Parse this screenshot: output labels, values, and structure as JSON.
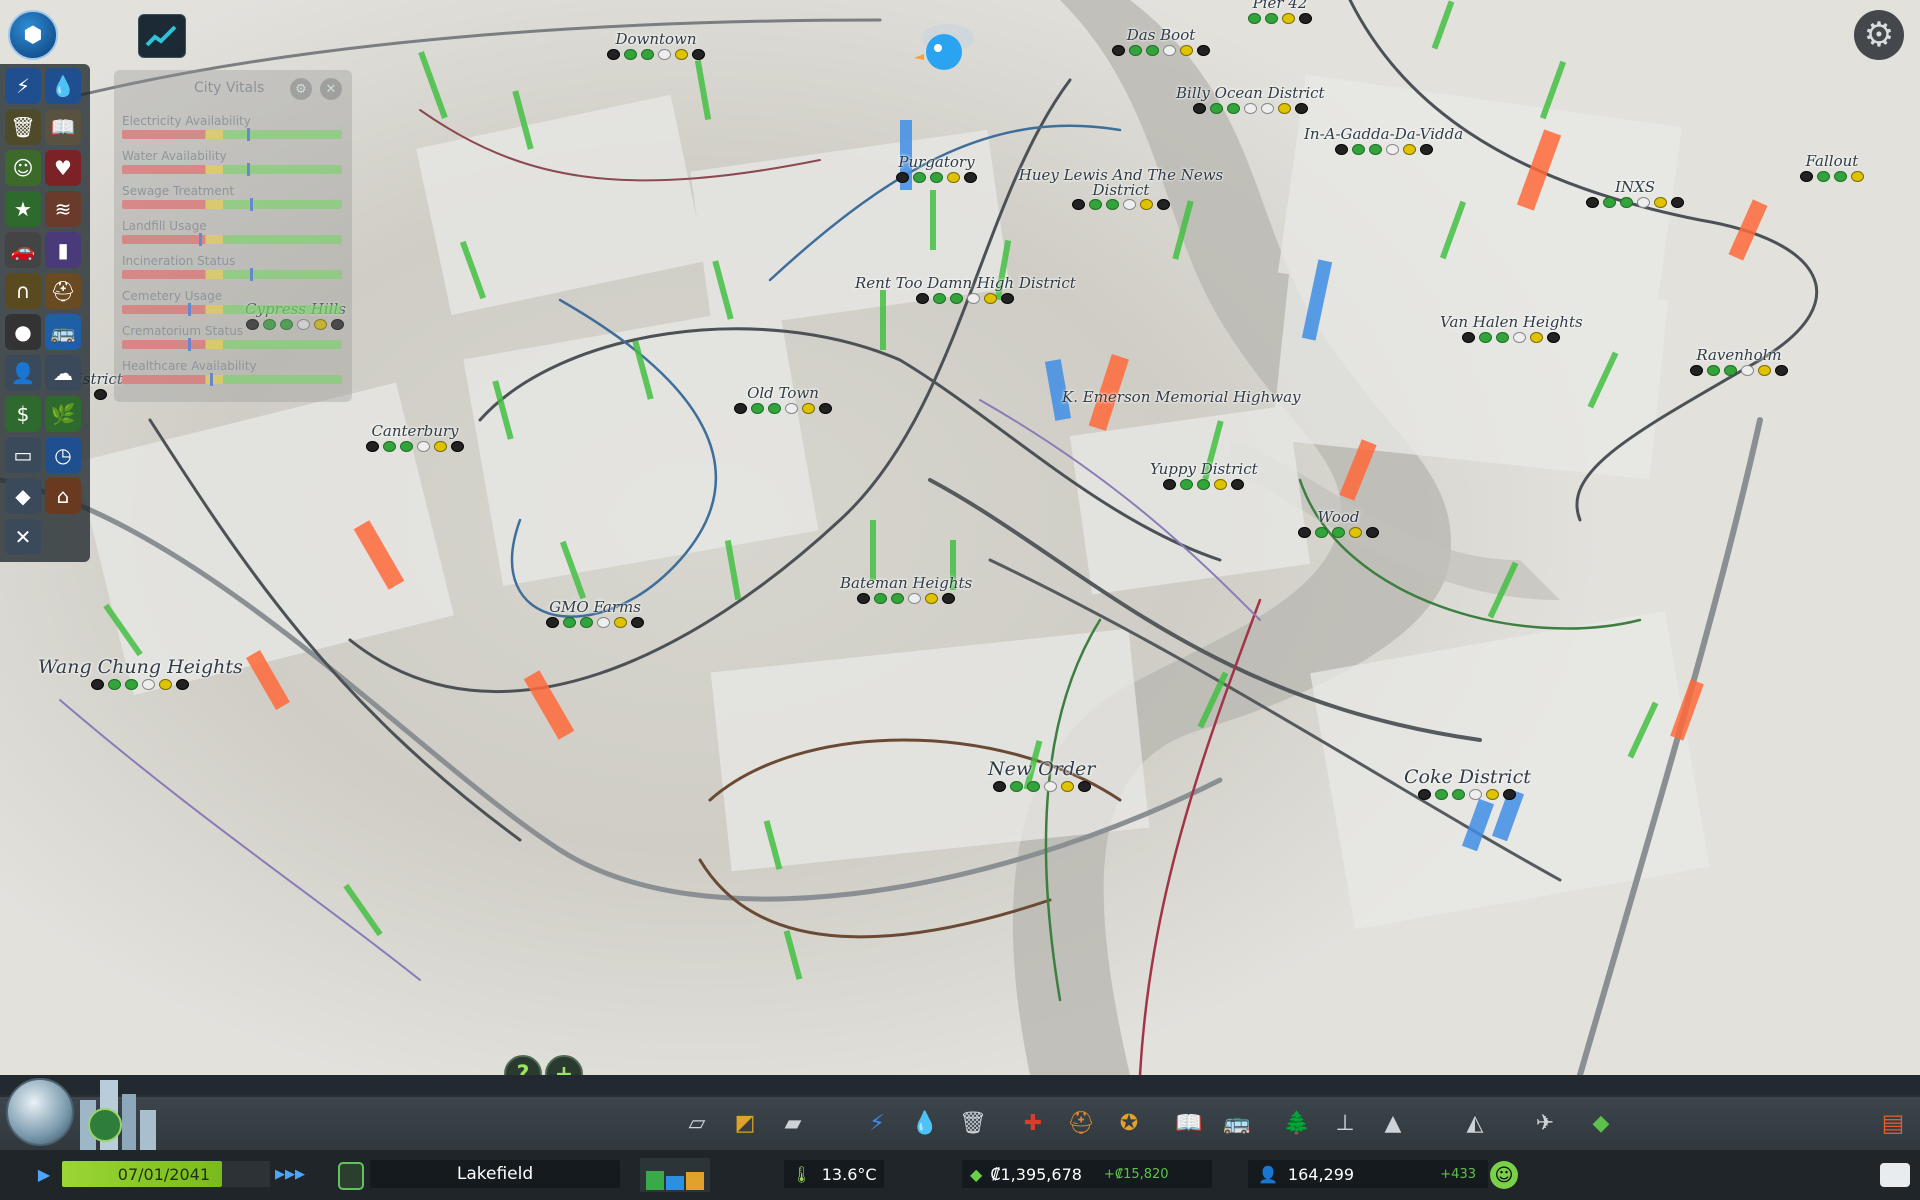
{
  "districts": [
    {
      "name": "Downtown"
    },
    {
      "name": "Das Boot"
    },
    {
      "name": "Pier 42"
    },
    {
      "name": "Billy Ocean District"
    },
    {
      "name": "In-A-Gadda-Da-Vidda"
    },
    {
      "name": "Purgatory"
    },
    {
      "name": "Huey Lewis And The News District"
    },
    {
      "name": "INXS"
    },
    {
      "name": "Fallout"
    },
    {
      "name": "Rent Too Damn High District"
    },
    {
      "name": "Van Halen Heights"
    },
    {
      "name": "Cypress Hills"
    },
    {
      "name": "Ravenholm"
    },
    {
      "name": "istrict"
    },
    {
      "name": "Old Town"
    },
    {
      "name": "K. Emerson Memorial Highway"
    },
    {
      "name": "Canterbury"
    },
    {
      "name": "Yuppy District"
    },
    {
      "name": "Wood"
    },
    {
      "name": "Bateman Heights"
    },
    {
      "name": "GMO Farms"
    },
    {
      "name": "Wang Chung Heights"
    },
    {
      "name": "New Order"
    },
    {
      "name": "Coke District"
    }
  ],
  "city_vitals": {
    "title": "City Vitals",
    "rows": [
      {
        "label": "Electricity Availability",
        "level": 0.57
      },
      {
        "label": "Water Availability",
        "level": 0.57
      },
      {
        "label": "Sewage Treatment",
        "level": 0.58
      },
      {
        "label": "Landfill Usage",
        "level": 0.35
      },
      {
        "label": "Incineration Status",
        "level": 0.58
      },
      {
        "label": "Cemetery Usage",
        "level": 0.3
      },
      {
        "label": "Crematorium Status",
        "level": 0.3
      },
      {
        "label": "Healthcare Availability",
        "level": 0.4
      }
    ]
  },
  "icons": {
    "logo": "cities-logo-icon",
    "stats": "statistics-icon",
    "chirper": "chirper-bird-icon",
    "settings": "gear-icon"
  },
  "left_toolbar": [
    "electricity-icon",
    "water-icon",
    "garbage-icon",
    "education-icon",
    "happiness-icon",
    "health-icon",
    "level-icon",
    "wind-icon",
    "traffic-icon",
    "landvalue-icon",
    "noise-icon",
    "fire-icon",
    "crime-icon",
    "transport-icon",
    "population-icon",
    "pollution-icon",
    "money-icon",
    "natural-resources-icon",
    "districts-icon",
    "outside-connections-icon",
    "terrain-icon",
    "fire-hazard-icon",
    "tools-icon"
  ],
  "help": {
    "help_label": "?",
    "add_label": "+"
  },
  "bottom_tools": [
    "roads-icon",
    "zoning-icon",
    "districts-tool-icon",
    "electricity-tool-icon",
    "water-tool-icon",
    "garbage-tool-icon",
    "healthcare-tool-icon",
    "fire-tool-icon",
    "police-tool-icon",
    "education-tool-icon",
    "transport-tool-icon",
    "parks-tool-icon",
    "unique-buildings-icon",
    "monuments-icon",
    "wonders-icon",
    "landscaping-icon",
    "money-tool-icon",
    "policies-icon",
    "bulldozer-icon"
  ],
  "status_bar": {
    "date": "07/01/2041",
    "city_name": "Lakefield",
    "temperature": "13.6°C",
    "money": "₡1,395,678",
    "money_delta": "+₡15,820",
    "population": "164,299",
    "population_delta": "+433",
    "colors": {
      "date_bar": "#8cc92a",
      "positive": "#5ec04c",
      "accent": "#4ca6ff"
    }
  },
  "demand": {
    "residential": 0.6,
    "commercial": 0.45,
    "industrial": 0.55
  }
}
